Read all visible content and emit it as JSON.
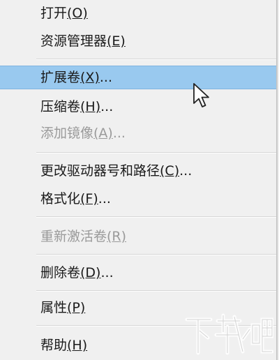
{
  "menu": {
    "items": [
      {
        "label": "打开",
        "accel": "(O)",
        "suffix": ""
      },
      {
        "label": "资源管理器",
        "accel": "(E)",
        "suffix": ""
      },
      {
        "label": "扩展卷",
        "accel": "(X)",
        "suffix": "..."
      },
      {
        "label": "压缩卷",
        "accel": "(H)",
        "suffix": "..."
      },
      {
        "label": "添加镜像",
        "accel": "(A)",
        "suffix": "..."
      },
      {
        "label": "更改驱动器号和路径",
        "accel": "(C)",
        "suffix": "..."
      },
      {
        "label": "格式化",
        "accel": "(F)",
        "suffix": "..."
      },
      {
        "label": "重新激活卷",
        "accel": "(R)",
        "suffix": ""
      },
      {
        "label": "删除卷",
        "accel": "(D)",
        "suffix": "..."
      },
      {
        "label": "属性",
        "accel": "(P)",
        "suffix": ""
      },
      {
        "label": "帮助",
        "accel": "(H)",
        "suffix": ""
      }
    ],
    "highlighted_item": "扩展卷",
    "highlight_color": "#99c9ef",
    "disabled_color": "#9a9a9a"
  },
  "cursor": {
    "icon": "mouse-pointer-icon"
  },
  "watermark": {
    "text": "下载吧",
    "icon": "watermark-logo"
  }
}
